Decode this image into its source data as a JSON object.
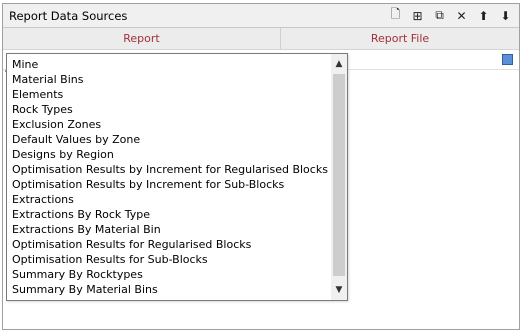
{
  "panel": {
    "title": "Report Data Sources",
    "toolbar": [
      {
        "icon": "new-document-icon",
        "glyph": "🗋"
      },
      {
        "icon": "add-child-icon",
        "glyph": "⊞"
      },
      {
        "icon": "copy-icon",
        "glyph": "⧉"
      },
      {
        "icon": "delete-icon",
        "glyph": "✕"
      },
      {
        "icon": "move-up-icon",
        "glyph": "⬆"
      },
      {
        "icon": "move-down-icon",
        "glyph": "⬇"
      }
    ]
  },
  "tabs": [
    {
      "label": "Report"
    },
    {
      "label": "Report File"
    }
  ],
  "dropdown": {
    "items": [
      "Mine",
      "Material Bins",
      "Elements",
      "Rock Types",
      "Exclusion Zones",
      "Default Values by Zone",
      "Designs by Region",
      "Optimisation Results by Increment for Regularised Blocks",
      "Optimisation Results by Increment for Sub-Blocks",
      "Extractions",
      "Extractions By Rock Type",
      "Extractions By Material Bin",
      "Optimisation Results for Regularised Blocks",
      "Optimisation Results for Sub-Blocks",
      "Summary By Rocktypes",
      "Summary By Material Bins"
    ],
    "scroll_up": "▲",
    "scroll_down": "▼"
  }
}
